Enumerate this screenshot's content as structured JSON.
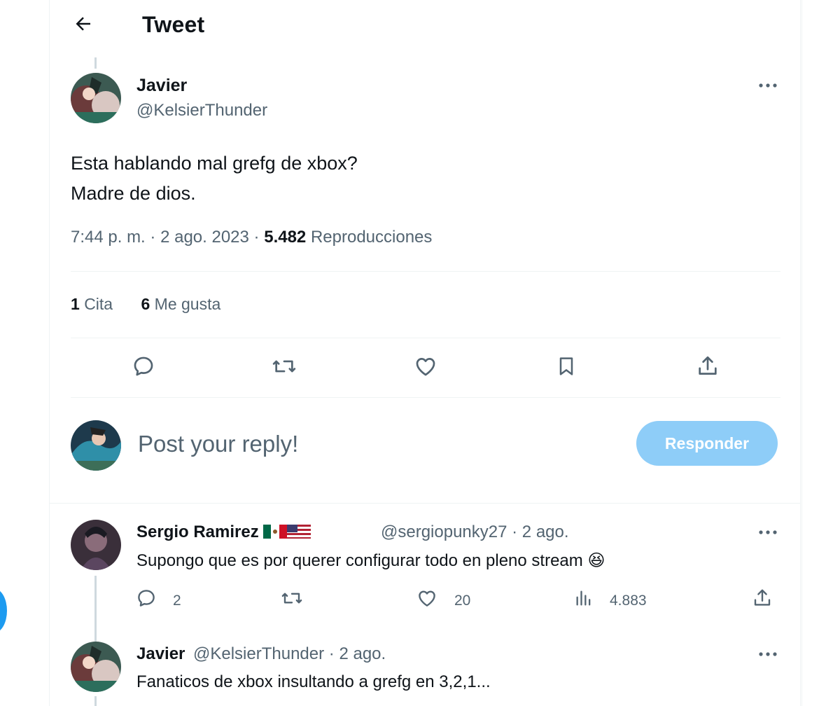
{
  "header": {
    "title": "Tweet"
  },
  "tweet": {
    "author_name": "Javier",
    "author_handle": "@KelsierThunder",
    "text": "Esta hablando mal grefg de xbox?\nMadre de dios.",
    "time": "7:44 p. m.",
    "date": "2 ago. 2023",
    "views_count": "5.482",
    "views_label": "Reproducciones",
    "quotes_count": "1",
    "quotes_label": "Cita",
    "likes_count": "6",
    "likes_label": "Me gusta"
  },
  "actions": [
    "reply-icon",
    "retweet-icon",
    "like-icon",
    "bookmark-icon",
    "share-icon"
  ],
  "reply_box": {
    "placeholder": "Post your reply!",
    "button_label": "Responder"
  },
  "replies": [
    {
      "name": "Sergio Ramirez",
      "handle": "@sergiopunky27",
      "time": "· 2 ago.",
      "text": "Supongo que es por querer configurar todo en pleno stream",
      "emoji": "😆",
      "reply_count": "2",
      "like_count": "20",
      "view_count": "4.883"
    },
    {
      "name": "Javier",
      "handle": "@KelsierThunder",
      "time": "· 2 ago.",
      "text": "Fanaticos de xbox insultando a grefg en 3,2,1..."
    }
  ],
  "colors": {
    "accent": "#1d9bf0",
    "button_disabled": "#8ecdf8",
    "secondary_text": "#536471",
    "border": "#eff3f4",
    "thread_line": "#cfd9de"
  }
}
